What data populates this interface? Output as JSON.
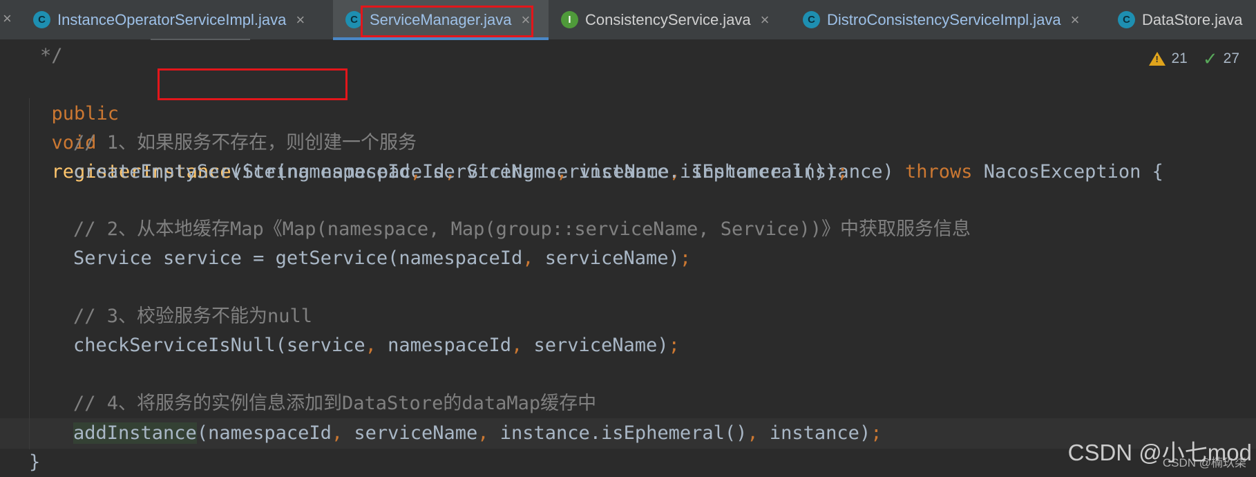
{
  "tabs": [
    {
      "label": "InstanceOperatorServiceImpl.java",
      "icon": "C",
      "kind": "class"
    },
    {
      "label": "ServiceManager.java",
      "icon": "C",
      "kind": "class",
      "active": true
    },
    {
      "label": "ConsistencyService.java",
      "icon": "I",
      "kind": "interface"
    },
    {
      "label": "DistroConsistencyServiceImpl.java",
      "icon": "C",
      "kind": "class"
    },
    {
      "label": "DataStore.java",
      "icon": "C",
      "kind": "class"
    }
  ],
  "close_glyph": "×",
  "inspection": {
    "warnings": "21",
    "checks": "27"
  },
  "code": {
    "comment_end": "*/",
    "sig": {
      "public": "public",
      "void": "void",
      "method": "registerInstance",
      "params_a": "(String namespaceId",
      "comma": ",",
      "params_b": " String serviceName",
      "params_c": " Instance instance) ",
      "throws": "throws",
      "exception": " NacosException {"
    },
    "c1": "// 1、如果服务不存在，则创建一个服务",
    "l1": {
      "a": "createEmptyService(namespaceId",
      "b": " serviceName",
      "c": " instance.isEphemeral())",
      "semi": ";"
    },
    "c2": "// 2、从本地缓存Map《Map(namespace, Map(group::serviceName, Service))》中获取服务信息",
    "l2": {
      "a": "Service service = getService(namespaceId",
      "b": " serviceName)",
      "semi": ";"
    },
    "c3": "// 3、校验服务不能为null",
    "l3": {
      "a": "checkServiceIsNull(service",
      "b": " namespaceId",
      "c": " serviceName)",
      "semi": ";"
    },
    "c4": "// 4、将服务的实例信息添加到DataStore的dataMap缓存中",
    "l4": {
      "fn": "addInstance",
      "a": "(namespaceId",
      "b": " serviceName",
      "c": " instance.isEphemeral()",
      "d": " instance)",
      "semi": ";"
    },
    "close": "}"
  },
  "watermark": {
    "main": "CSDN @小七mod",
    "small": "CSDN @楠玖柒"
  },
  "colors": {
    "keyword": "#cc7832",
    "comment": "#808080",
    "method": "#ffc66d",
    "text": "#a9b7c6",
    "highlight": "#e3161b"
  }
}
